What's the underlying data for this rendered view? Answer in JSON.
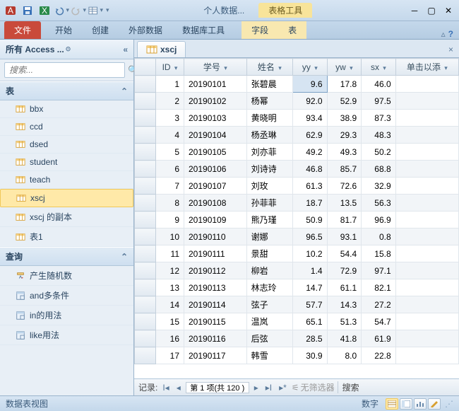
{
  "titlebar": {
    "app_title": "个人数据...",
    "contextual_title": "表格工具"
  },
  "ribbon": {
    "file": "文件",
    "tabs": [
      "开始",
      "创建",
      "外部数据",
      "数据库工具"
    ],
    "contextual_tabs": [
      "字段",
      "表"
    ]
  },
  "nav": {
    "header": "所有 Access ...",
    "search_placeholder": "搜索...",
    "groups": [
      {
        "name": "表",
        "items": [
          "bbx",
          "ccd",
          "dsed",
          "student",
          "teach",
          "xscj",
          "xscj 的副本",
          "表1"
        ],
        "selected": "xscj",
        "icon": "table"
      },
      {
        "name": "查询",
        "items": [
          "产生随机数",
          "and多条件",
          "in的用法",
          "like用法"
        ],
        "icon": "query"
      }
    ]
  },
  "object_tab": "xscj",
  "chart_data": {
    "type": "table",
    "columns": [
      "ID",
      "学号",
      "姓名",
      "yy",
      "yw",
      "sx",
      "单击以添"
    ],
    "rows": [
      [
        1,
        "20190101",
        "张碧晨",
        9.6,
        17.8,
        46.0,
        ""
      ],
      [
        2,
        "20190102",
        "杨幂",
        92.0,
        52.9,
        97.5,
        ""
      ],
      [
        3,
        "20190103",
        "黄晓明",
        93.4,
        38.9,
        87.3,
        ""
      ],
      [
        4,
        "20190104",
        "杨丞琳",
        62.9,
        29.3,
        48.3,
        ""
      ],
      [
        5,
        "20190105",
        "刘亦菲",
        49.2,
        49.3,
        50.2,
        ""
      ],
      [
        6,
        "20190106",
        "刘诗诗",
        46.8,
        85.7,
        68.8,
        ""
      ],
      [
        7,
        "20190107",
        "刘玫",
        61.3,
        72.6,
        32.9,
        ""
      ],
      [
        8,
        "20190108",
        "孙菲菲",
        18.7,
        13.5,
        56.3,
        ""
      ],
      [
        9,
        "20190109",
        "熊乃瑾",
        50.9,
        81.7,
        96.9,
        ""
      ],
      [
        10,
        "20190110",
        "谢娜",
        96.5,
        93.1,
        0.8,
        ""
      ],
      [
        11,
        "20190111",
        "景甜",
        10.2,
        54.4,
        15.8,
        ""
      ],
      [
        12,
        "20190112",
        "柳岩",
        1.4,
        72.9,
        97.1,
        ""
      ],
      [
        13,
        "20190113",
        "林志玲",
        14.7,
        61.1,
        82.1,
        ""
      ],
      [
        14,
        "20190114",
        "弦子",
        57.7,
        14.3,
        27.2,
        ""
      ],
      [
        15,
        "20190115",
        "温岚",
        65.1,
        51.3,
        54.7,
        ""
      ],
      [
        16,
        "20190116",
        "后弦",
        28.5,
        41.8,
        61.9,
        ""
      ],
      [
        17,
        "20190117",
        "韩雪",
        30.9,
        8.0,
        22.8,
        ""
      ]
    ],
    "selected_cell": [
      0,
      3
    ]
  },
  "recnav": {
    "label": "记录:",
    "pos": "第 1 项(共 120 )",
    "filter": "无筛选器",
    "search": "搜索"
  },
  "status": {
    "view": "数据表视图",
    "numlock": "数字"
  }
}
